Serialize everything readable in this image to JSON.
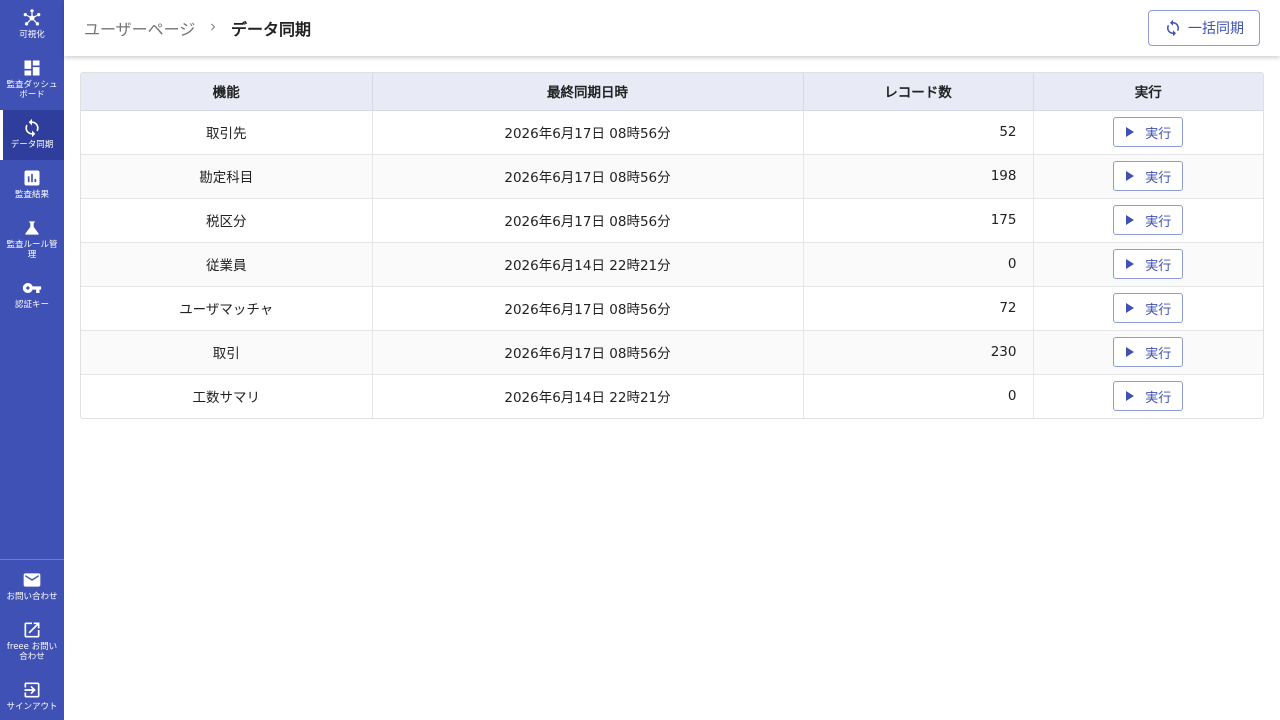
{
  "sidebar": {
    "top_items": [
      {
        "label": "可視化",
        "icon": "hub-icon",
        "active": false
      },
      {
        "label": "監査ダッシュ\nボード",
        "icon": "dashboard-icon",
        "active": false
      },
      {
        "label": "データ同期",
        "icon": "sync-icon",
        "active": true
      },
      {
        "label": "監査結果",
        "icon": "bar-chart-icon",
        "active": false
      },
      {
        "label": "監査ルール管\n理",
        "icon": "flask-icon",
        "active": false
      },
      {
        "label": "認証キー",
        "icon": "key-icon",
        "active": false
      }
    ],
    "bottom_items": [
      {
        "label": "お問い合わせ",
        "icon": "mail-icon"
      },
      {
        "label": "freee お問い\n合わせ",
        "icon": "external-link-icon"
      },
      {
        "label": "サインアウト",
        "icon": "logout-icon"
      }
    ]
  },
  "header": {
    "breadcrumb_parent": "ユーザーページ",
    "breadcrumb_current": "データ同期",
    "bulk_sync_label": "一括同期"
  },
  "table": {
    "columns": [
      "機能",
      "最終同期日時",
      "レコード数",
      "実行"
    ],
    "run_label": "実行",
    "rows": [
      {
        "name": "取引先",
        "last_sync": "2026年6月17日 08時56分",
        "count": "52"
      },
      {
        "name": "勘定科目",
        "last_sync": "2026年6月17日 08時56分",
        "count": "198"
      },
      {
        "name": "税区分",
        "last_sync": "2026年6月17日 08時56分",
        "count": "175"
      },
      {
        "name": "従業員",
        "last_sync": "2026年6月14日 22時21分",
        "count": "0"
      },
      {
        "name": "ユーザマッチャ",
        "last_sync": "2026年6月17日 08時56分",
        "count": "72"
      },
      {
        "name": "取引",
        "last_sync": "2026年6月17日 08時56分",
        "count": "230"
      },
      {
        "name": "工数サマリ",
        "last_sync": "2026年6月14日 22時21分",
        "count": "0"
      }
    ]
  },
  "colors": {
    "primary": "#3f51b5",
    "header_bg": "#e8eaf6"
  }
}
